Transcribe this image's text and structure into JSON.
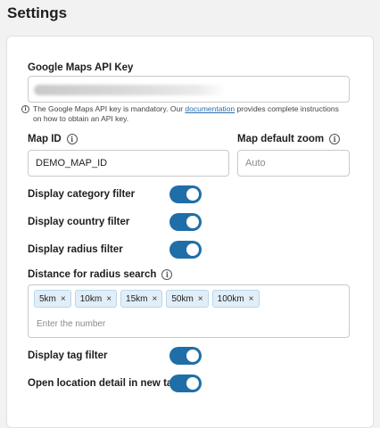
{
  "page": {
    "title": "Settings"
  },
  "api_key": {
    "label": "Google Maps API Key",
    "help_prefix": "The Google Maps API key is mandatory. Our ",
    "help_link": "documentation",
    "help_suffix": " provides complete instructions on how to obtain an API key."
  },
  "map_id": {
    "label": "Map ID",
    "value": "DEMO_MAP_ID"
  },
  "map_zoom": {
    "label": "Map default zoom",
    "placeholder": "Auto"
  },
  "toggles": {
    "category": {
      "label": "Display category filter",
      "on": true
    },
    "country": {
      "label": "Display country filter",
      "on": true
    },
    "radius": {
      "label": "Display radius filter",
      "on": true
    },
    "tag": {
      "label": "Display tag filter",
      "on": true
    },
    "new_tab": {
      "label": "Open location detail in new tab",
      "on": true
    }
  },
  "radius_search": {
    "label": "Distance for radius search",
    "tags": [
      "5km",
      "10km",
      "15km",
      "50km",
      "100km"
    ],
    "remove_symbol": "×",
    "placeholder": "Enter the number"
  },
  "icons": {
    "info": "i"
  },
  "colors": {
    "accent": "#1f6ea8",
    "link": "#2a6fb0",
    "tag_bg": "#e1eef8"
  }
}
